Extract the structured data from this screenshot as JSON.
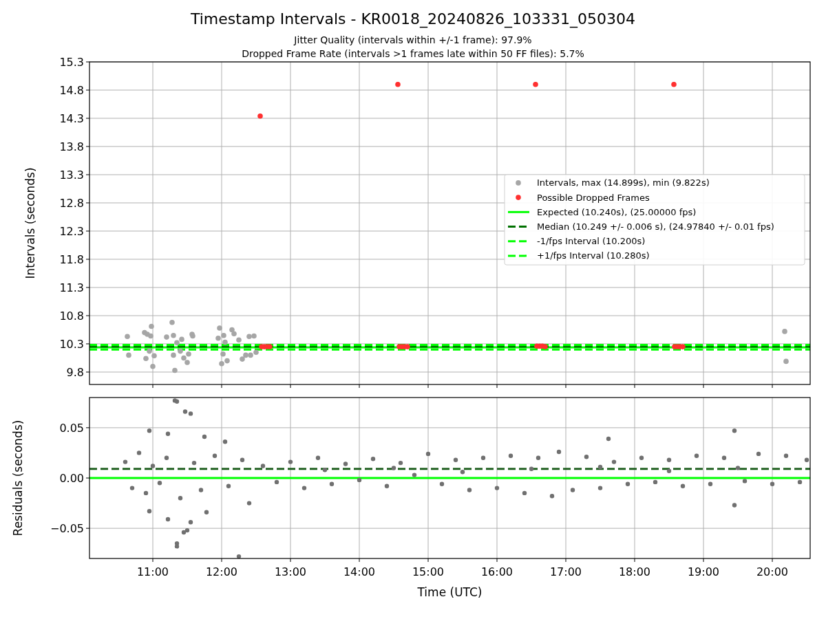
{
  "title": "Timestamp Intervals - KR0018_20240826_103331_050304",
  "subtitles": [
    "Jitter Quality (intervals within +/-1 frame): 97.9%",
    "Dropped Frame Rate (intervals >1 frames late within 50 FF files): 5.7%"
  ],
  "interval_chart": {
    "chart_data": {
      "type": "scatter",
      "grid": true,
      "legend": "center right",
      "ylabel": "Intervals (seconds)",
      "xlim": [
        10.08,
        20.55
      ],
      "ylim": [
        9.58,
        15.3
      ],
      "yticks": [
        {
          "value": 9.8,
          "label": "9.8"
        },
        {
          "value": 10.3,
          "label": "10.3"
        },
        {
          "value": 10.8,
          "label": "10.8"
        },
        {
          "value": 11.3,
          "label": "11.3"
        },
        {
          "value": 11.8,
          "label": "11.8"
        },
        {
          "value": 12.3,
          "label": "12.3"
        },
        {
          "value": 12.8,
          "label": "12.8"
        },
        {
          "value": 13.3,
          "label": "13.3"
        },
        {
          "value": 13.8,
          "label": "13.8"
        },
        {
          "value": 14.3,
          "label": "14.3"
        },
        {
          "value": 14.8,
          "label": "14.8"
        },
        {
          "value": 15.3,
          "label": "15.3"
        }
      ],
      "series": [
        {
          "name": "Intervals, max (14.899s), min (9.822s)",
          "color": "#a6a6a6",
          "x": [
            10.63,
            10.65,
            10.88,
            10.9,
            10.92,
            10.95,
            10.97,
            10.98,
            11.0,
            11.02,
            11.2,
            11.28,
            11.3,
            11.3,
            11.32,
            11.35,
            11.4,
            11.42,
            11.45,
            11.5,
            11.52,
            11.57,
            11.58,
            11.95,
            11.97,
            12.0,
            12.02,
            12.03,
            12.05,
            12.08,
            12.15,
            12.18,
            12.25,
            12.3,
            12.35,
            12.4,
            12.42,
            12.47,
            12.5,
            20.18,
            20.2
          ],
          "values": [
            10.43,
            10.1,
            10.5,
            10.04,
            10.47,
            10.17,
            10.44,
            10.61,
            9.9,
            10.09,
            10.42,
            10.68,
            10.45,
            10.1,
            9.83,
            10.32,
            10.17,
            10.38,
            10.05,
            9.97,
            10.12,
            10.47,
            10.44,
            10.4,
            10.58,
            9.95,
            10.12,
            10.45,
            10.33,
            10.0,
            10.55,
            10.48,
            10.37,
            10.03,
            10.1,
            10.43,
            10.1,
            10.44,
            10.15,
            10.52,
            9.99
          ]
        },
        {
          "name": "Possible Dropped Frames",
          "color": "#ff3030",
          "x": [
            12.56,
            12.58,
            12.62,
            12.66,
            12.7,
            14.56,
            14.58,
            14.62,
            14.66,
            14.7,
            16.56,
            16.58,
            16.62,
            16.66,
            16.7,
            18.57,
            18.58,
            18.62,
            18.66,
            18.7
          ],
          "values": [
            14.34,
            10.25,
            10.25,
            10.25,
            10.25,
            14.9,
            10.25,
            10.25,
            10.25,
            10.25,
            14.9,
            10.26,
            10.26,
            10.26,
            10.25,
            14.9,
            10.25,
            10.25,
            10.25,
            10.25
          ]
        }
      ],
      "ref_lines": [
        {
          "axis": "y",
          "value": 10.24,
          "label": "Expected (10.240s), (25.00000 fps)",
          "color": "#00ff00"
        },
        {
          "axis": "y",
          "value": 10.249,
          "label": "Median (10.249 +/- 0.006 s), (24.97840 +/- 0.01 fps)",
          "color": "#007000"
        },
        {
          "axis": "y",
          "value": 10.2,
          "label": "-1/fps Interval (10.200s)",
          "color": "#00ff00"
        },
        {
          "axis": "y",
          "value": 10.28,
          "label": "+1/fps Interval (10.280s)",
          "color": "#00ff00"
        }
      ]
    }
  },
  "residual_chart": {
    "chart_data": {
      "type": "scatter",
      "xlabel": "Time (UTC)",
      "ylabel": "Residuals (seconds)",
      "xlim": [
        10.08,
        20.55
      ],
      "ylim": [
        -0.08,
        0.08
      ],
      "xticks": [
        {
          "value": 11,
          "label": "11:00"
        },
        {
          "value": 12,
          "label": "12:00"
        },
        {
          "value": 13,
          "label": "13:00"
        },
        {
          "value": 14,
          "label": "14:00"
        },
        {
          "value": 15,
          "label": "15:00"
        },
        {
          "value": 16,
          "label": "16:00"
        },
        {
          "value": 17,
          "label": "17:00"
        },
        {
          "value": 18,
          "label": "18:00"
        },
        {
          "value": 19,
          "label": "19:00"
        },
        {
          "value": 20,
          "label": "20:00"
        }
      ],
      "yticks": [
        {
          "value": 0.05,
          "label": "0.05"
        },
        {
          "value": 0,
          "label": "0.00"
        },
        {
          "value": -0.05,
          "label": "−0.05"
        }
      ],
      "series": [
        {
          "color": "#707070",
          "x": [
            11.32,
            11.35,
            11.47,
            11.55,
            10.95,
            11.22,
            11.75,
            11.35,
            11.35,
            11.45,
            11.5,
            11.55,
            11.78,
            10.95,
            11.22,
            12.25,
            17.62,
            19.45,
            19.45,
            12.05,
            10.6,
            10.7,
            10.8,
            10.9,
            11.0,
            11.1,
            11.2,
            11.4,
            11.6,
            11.7,
            11.9,
            12.1,
            12.3,
            12.4,
            12.6,
            12.8,
            13.0,
            13.2,
            13.4,
            13.6,
            13.8,
            14.0,
            14.2,
            14.4,
            14.6,
            14.8,
            15.0,
            15.2,
            15.4,
            15.6,
            15.8,
            16.0,
            16.2,
            16.4,
            16.6,
            16.8,
            16.9,
            17.1,
            17.3,
            17.5,
            17.7,
            17.9,
            18.1,
            18.3,
            18.5,
            18.7,
            18.9,
            19.1,
            19.3,
            19.6,
            19.8,
            20.0,
            20.2,
            20.4,
            20.5,
            13.5,
            14.5,
            15.5,
            16.5,
            17.5,
            18.5,
            19.5
          ],
          "values": [
            0.077,
            0.076,
            0.066,
            0.064,
            0.047,
            0.044,
            0.041,
            -0.065,
            -0.068,
            -0.054,
            -0.052,
            -0.044,
            -0.034,
            -0.033,
            -0.041,
            -0.078,
            0.039,
            0.047,
            -0.027,
            0.036,
            0.016,
            -0.01,
            0.025,
            -0.015,
            0.012,
            -0.005,
            0.02,
            -0.02,
            0.015,
            -0.012,
            0.022,
            -0.008,
            0.018,
            -0.025,
            0.012,
            -0.004,
            0.016,
            -0.01,
            0.02,
            -0.006,
            0.014,
            -0.002,
            0.019,
            -0.008,
            0.015,
            0.003,
            0.024,
            -0.006,
            0.018,
            -0.012,
            0.02,
            -0.01,
            0.022,
            -0.015,
            0.02,
            -0.018,
            0.026,
            -0.012,
            0.021,
            -0.01,
            0.016,
            -0.006,
            0.02,
            -0.004,
            0.018,
            -0.008,
            0.022,
            -0.006,
            0.02,
            -0.003,
            0.024,
            -0.006,
            0.022,
            -0.004,
            0.018,
            0.008,
            0.01,
            0.006,
            0.009,
            0.011,
            0.007,
            0.01
          ]
        }
      ],
      "ref_lines": [
        {
          "axis": "y",
          "value": 0,
          "color": "#00ff00"
        },
        {
          "axis": "y",
          "value": 0.009,
          "color": "#206020"
        }
      ],
      "grid": true
    }
  }
}
